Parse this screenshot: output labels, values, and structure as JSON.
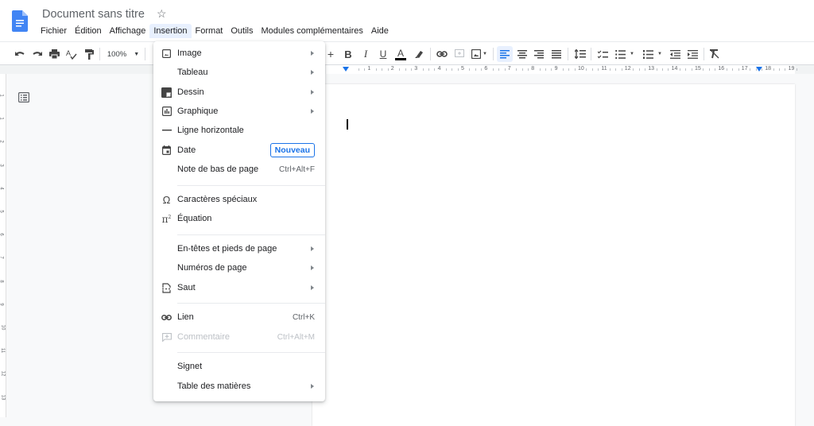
{
  "app": {
    "title": "Document sans titre",
    "star_icon": "star-icon",
    "logo_icon": "google-docs-icon"
  },
  "menubar": {
    "items": [
      "Fichier",
      "Édition",
      "Affichage",
      "Insertion",
      "Format",
      "Outils",
      "Modules complémentaires",
      "Aide"
    ],
    "active": "Insertion"
  },
  "toolbar": {
    "zoom": "100%",
    "icons": [
      "undo-icon",
      "redo-icon",
      "print-icon",
      "spellcheck-icon",
      "paint-format-icon",
      "zoom-dropdown",
      "increase-font-size-icon",
      "bold-icon",
      "italic-icon",
      "underline-icon",
      "text-color-icon",
      "highlight-icon",
      "link-icon",
      "comment-icon",
      "insert-image-icon",
      "align-left-icon",
      "align-center-icon",
      "align-right-icon",
      "justify-icon",
      "line-spacing-icon",
      "checklist-icon",
      "bulleted-list-icon",
      "numbered-list-icon",
      "decrease-indent-icon",
      "increase-indent-icon",
      "clear-formatting-icon"
    ],
    "text_color": "#000000",
    "accent": "#1a73e8"
  },
  "ruler": {
    "numbers": [
      "1",
      "2",
      "3",
      "4",
      "5",
      "6",
      "7",
      "8",
      "9",
      "10",
      "11",
      "12",
      "13",
      "14",
      "15",
      "16",
      "17",
      "18",
      "19"
    ],
    "vertical_numbers": [
      "1",
      "1",
      "2",
      "3",
      "4",
      "5",
      "6",
      "7",
      "8",
      "9",
      "10",
      "11",
      "12",
      "13"
    ]
  },
  "insert_menu": {
    "items": [
      {
        "label": "Image",
        "icon": "image-icon",
        "submenu": true
      },
      {
        "label": "Tableau",
        "icon": "",
        "submenu": true
      },
      {
        "label": "Dessin",
        "icon": "drawing-icon",
        "submenu": true
      },
      {
        "label": "Graphique",
        "icon": "chart-icon",
        "submenu": true
      },
      {
        "label": "Ligne horizontale",
        "icon": "horizontal-line-icon"
      },
      {
        "label": "Date",
        "icon": "calendar-icon",
        "badge": "Nouveau"
      },
      {
        "label": "Note de bas de page",
        "icon": "",
        "shortcut": "Ctrl+Alt+F"
      },
      {
        "label": "Caractères spéciaux",
        "icon": "omega-icon"
      },
      {
        "label": "Équation",
        "icon": "pi-squared-icon"
      },
      {
        "label": "En-têtes et pieds de page",
        "icon": "",
        "submenu": true
      },
      {
        "label": "Numéros de page",
        "icon": "",
        "submenu": true
      },
      {
        "label": "Saut",
        "icon": "page-break-icon",
        "submenu": true
      },
      {
        "label": "Lien",
        "icon": "link-icon",
        "shortcut": "Ctrl+K"
      },
      {
        "label": "Commentaire",
        "icon": "comment-icon",
        "shortcut": "Ctrl+Alt+M",
        "disabled": true
      },
      {
        "label": "Signet",
        "icon": ""
      },
      {
        "label": "Table des matières",
        "icon": "",
        "submenu": true
      }
    ]
  }
}
